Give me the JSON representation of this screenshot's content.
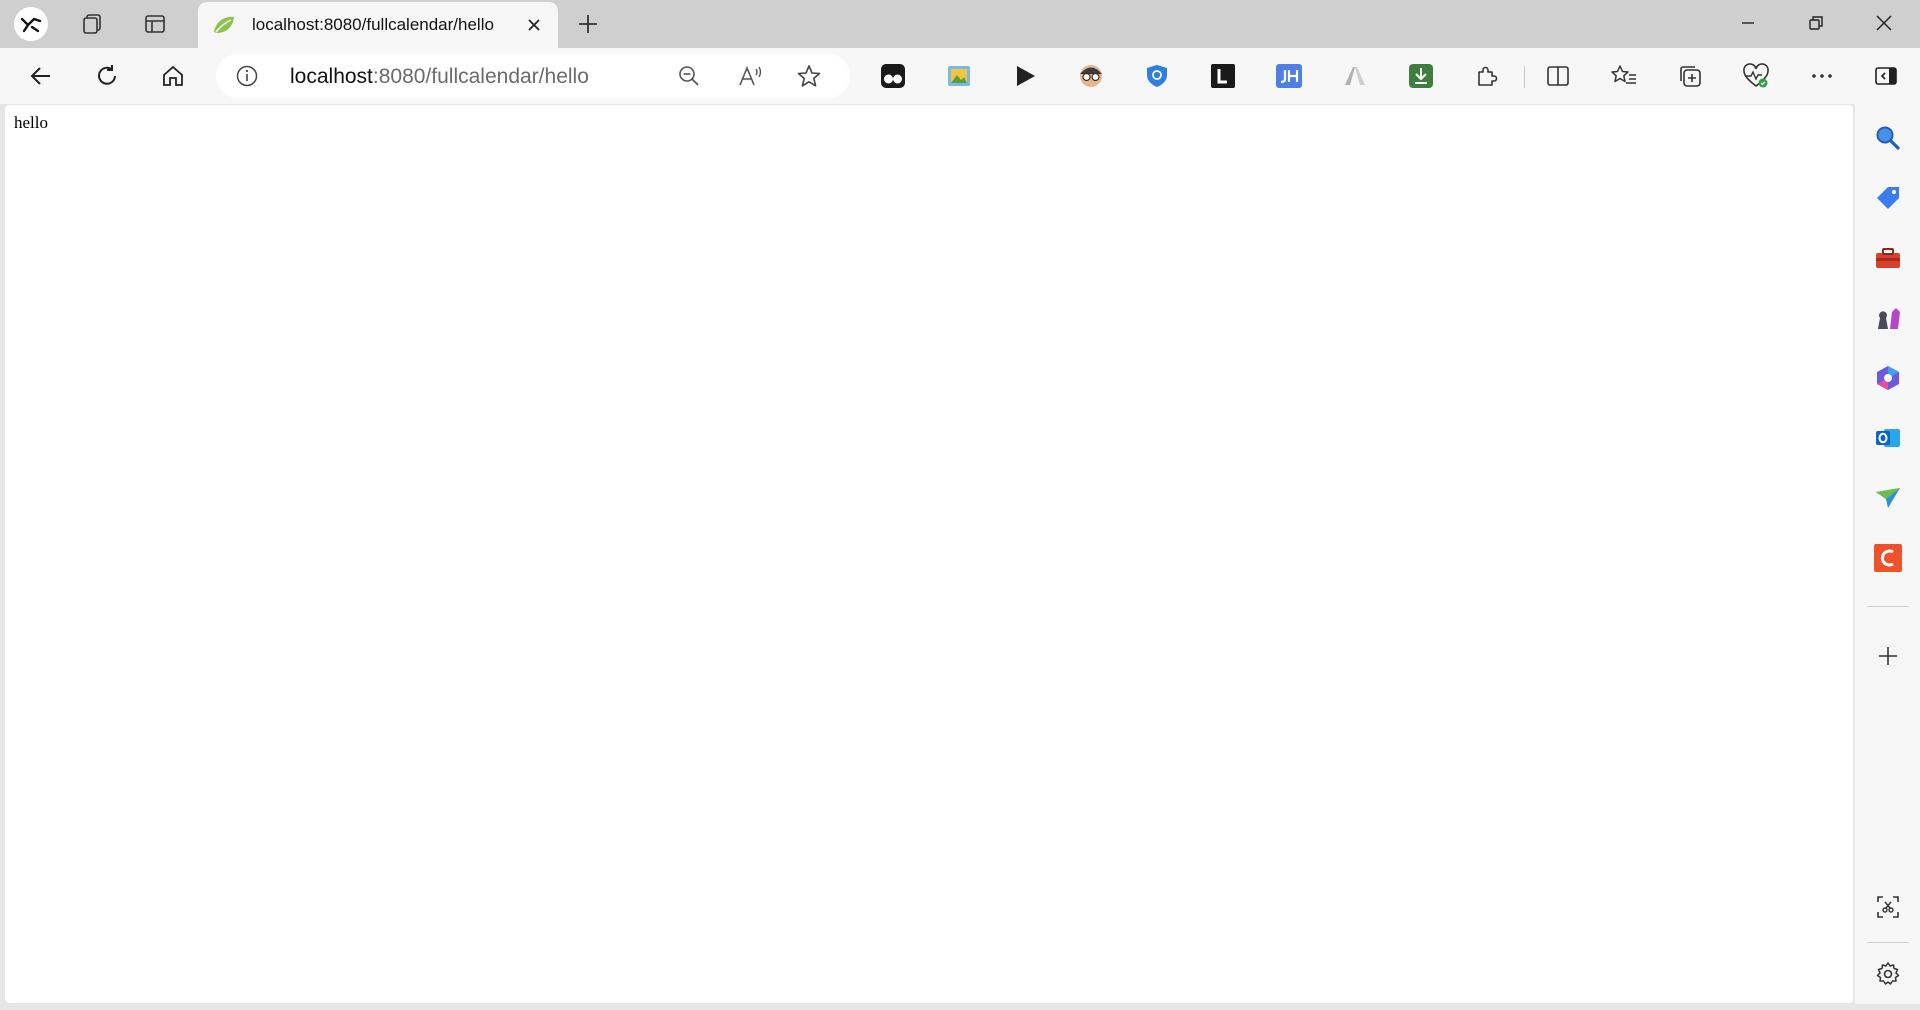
{
  "browser": {
    "tab": {
      "title": "localhost:8080/fullcalendar/hello",
      "favicon": "spring-leaf-icon"
    },
    "address": {
      "host": "localhost",
      "path": ":8080/fullcalendar/hello"
    },
    "toolbar_icons": [
      "back-icon",
      "refresh-icon",
      "home-icon",
      "info-icon",
      "zoom-out-icon",
      "read-aloud-icon",
      "favorite-star-icon"
    ],
    "extensions": [
      "tampermonkey-icon",
      "image-extension-icon",
      "play-icon",
      "hacker-face-icon",
      "shield-icon",
      "l-extension-icon",
      "jh-extension-icon",
      "arrow-extension-icon",
      "download-extension-icon",
      "extensions-puzzle-icon"
    ],
    "sidebar_apps": [
      "search-icon",
      "shopping-tag-icon",
      "tools-icon",
      "games-icon",
      "copilot-icon",
      "outlook-icon",
      "send-icon",
      "c-app-icon"
    ],
    "accent_color": "#0078d4"
  },
  "page": {
    "text": "hello"
  }
}
